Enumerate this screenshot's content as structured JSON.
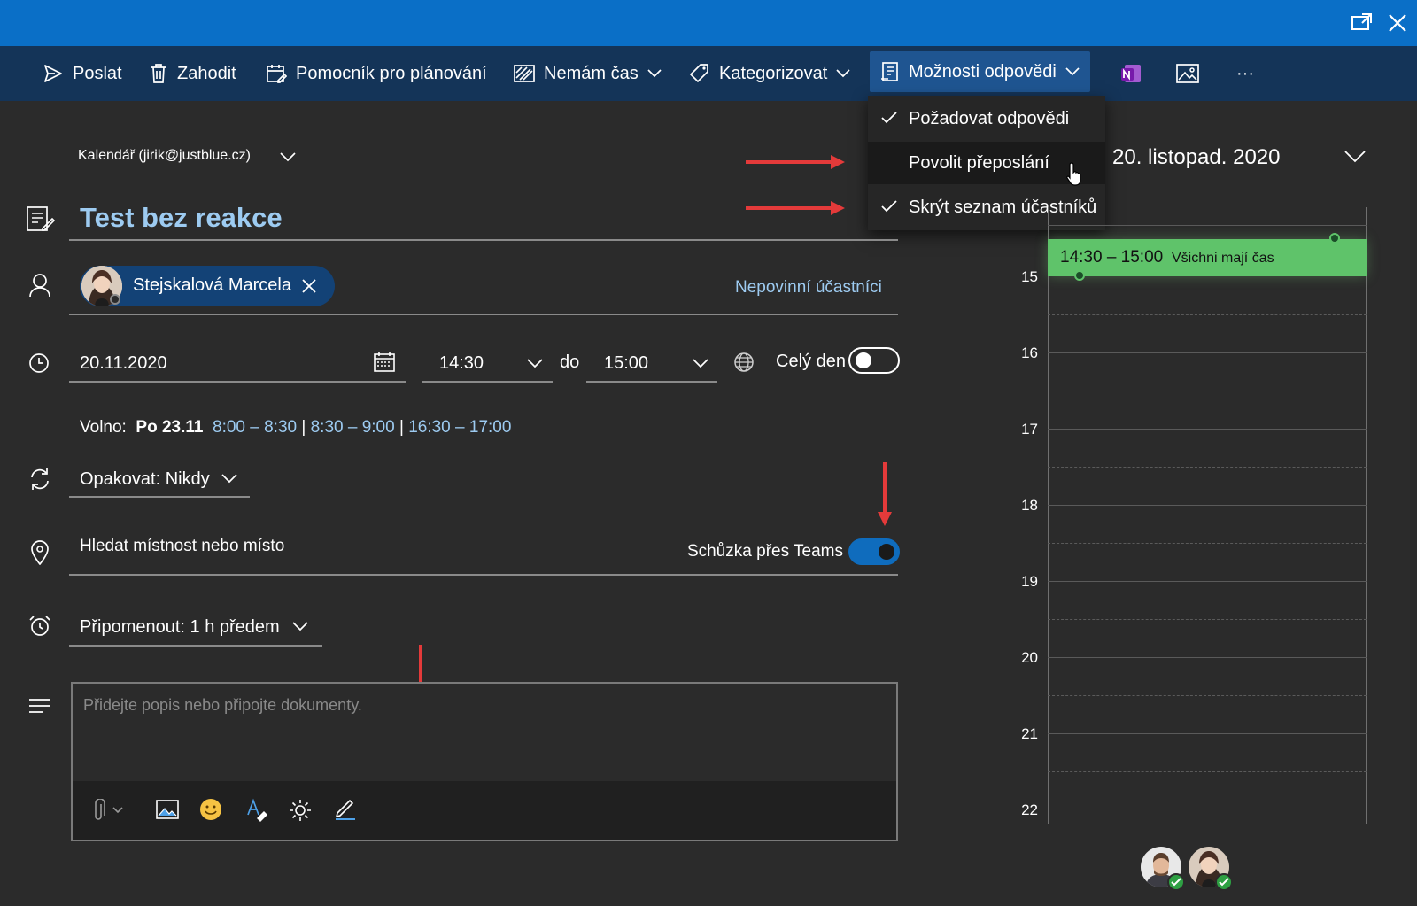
{
  "colors": {
    "titlebar": "#0a6fc7",
    "toolbar": "#143458",
    "accent_text": "#9dcbf1",
    "event_green": "#5fc36a",
    "arrow_red": "#e43a3a",
    "toggle_on": "#0f6cbd"
  },
  "toolbar": {
    "send": "Poslat",
    "discard": "Zahodit",
    "scheduling_assistant": "Pomocník pro plánování",
    "busy": "Nemám čas",
    "categorize": "Kategorizovat",
    "response_options": "Možnosti odpovědi",
    "more": "···"
  },
  "response_menu": {
    "items": [
      {
        "label": "Požadovat odpovědi",
        "checked": true
      },
      {
        "label": "Povolit přeposlání",
        "checked": false
      },
      {
        "label": "Skrýt seznam účastníků",
        "checked": true
      }
    ]
  },
  "form": {
    "calendar": "Kalendář (jirik@justblue.cz)",
    "title": "Test bez reakce",
    "attendee": "Stejskalová Marcela",
    "optional_attendees": "Nepovinní účastníci",
    "date": "20.11.2020",
    "start_time": "14:30",
    "to_label": "do",
    "end_time": "15:00",
    "all_day_label": "Celý den",
    "all_day_on": false,
    "free_label": "Volno:",
    "free_day": "Po 23.11",
    "free_slots": [
      "8:00 – 8:30",
      "8:30 – 9:00",
      "16:30 – 17:00"
    ],
    "free_sep": "|",
    "repeat": "Opakovat: Nikdy",
    "location_placeholder": "Hledat místnost nebo místo",
    "teams_label": "Schůzka přes Teams",
    "teams_on": true,
    "reminder": "Připomenout: 1 h předem",
    "description_placeholder": "Přidejte popis nebo připojte dokumenty."
  },
  "calendar_panel": {
    "date_header": "20. listopad. 2020",
    "hours": [
      "15",
      "16",
      "17",
      "18",
      "19",
      "20",
      "21",
      "22"
    ],
    "event_time": "14:30 – 15:00",
    "event_status": "Všichni mají čas"
  },
  "icons": [
    "popout-icon",
    "close-icon",
    "send-icon",
    "trash-icon",
    "scheduling-icon",
    "busy-icon",
    "tag-icon",
    "response-options-icon",
    "onenote-icon",
    "image-icon",
    "notes-icon",
    "person-icon",
    "clock-icon",
    "calendar-icon",
    "timezone-icon",
    "repeat-icon",
    "location-icon",
    "alarm-icon",
    "description-icon",
    "attach-icon",
    "insert-picture-icon",
    "emoji-icon",
    "format-icon",
    "sun-icon",
    "draw-icon"
  ]
}
